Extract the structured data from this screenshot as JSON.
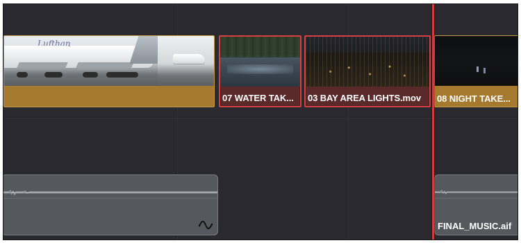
{
  "timeline": {
    "video_clips": [
      {
        "label": "",
        "thumbnail": "airplane"
      },
      {
        "label": "07 WATER TAK...",
        "thumbnail": "water"
      },
      {
        "label": "03 BAY AREA LIGHTS.mov",
        "thumbnail": "city-lights"
      },
      {
        "label": "08 NIGHT TAKE...",
        "thumbnail": "night"
      }
    ],
    "audio_clips": [
      {
        "label": "",
        "icon": "curve-icon"
      },
      {
        "label": "FINAL_MUSIC.aif"
      }
    ],
    "playhead": {
      "color": "#d43c3c"
    }
  },
  "colors": {
    "background": "#2a2930",
    "video_clip": "#a57a2e",
    "selected_outline": "#d64040",
    "audio_clip": "#55585d"
  }
}
